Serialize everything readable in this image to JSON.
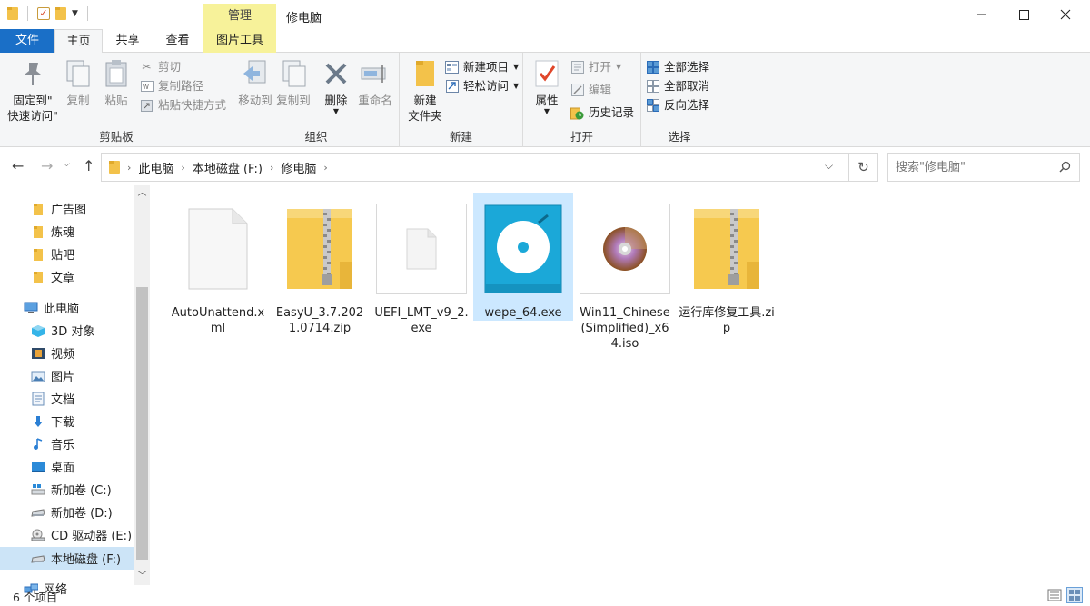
{
  "titlebar": {
    "context_tab": "管理",
    "title": "修电脑"
  },
  "tabs": {
    "file": "文件",
    "home": "主页",
    "share": "共享",
    "view": "查看",
    "picture_tools": "图片工具"
  },
  "ribbon": {
    "clipboard": {
      "label": "剪贴板",
      "pin_line1": "固定到\"",
      "pin_line2": "快速访问\"",
      "copy": "复制",
      "paste": "粘贴",
      "cut": "剪切",
      "copy_path": "复制路径",
      "paste_shortcut": "粘贴快捷方式"
    },
    "organize": {
      "label": "组织",
      "move_to": "移动到",
      "copy_to": "复制到",
      "delete": "删除",
      "rename": "重命名"
    },
    "new": {
      "label": "新建",
      "new_folder_line1": "新建",
      "new_folder_line2": "文件夹",
      "new_item": "新建项目",
      "easy_access": "轻松访问"
    },
    "open": {
      "label": "打开",
      "properties": "属性",
      "open": "打开",
      "edit": "编辑",
      "history": "历史记录"
    },
    "select": {
      "label": "选择",
      "select_all": "全部选择",
      "select_none": "全部取消",
      "invert": "反向选择"
    }
  },
  "address": {
    "crumbs": [
      "此电脑",
      "本地磁盘 (F:)",
      "修电脑"
    ],
    "search_placeholder": "搜索\"修电脑\""
  },
  "sidebar": {
    "items": [
      {
        "label": "广告图",
        "icon": "folder-icon"
      },
      {
        "label": "炼魂",
        "icon": "folder-icon"
      },
      {
        "label": "贴吧",
        "icon": "folder-icon"
      },
      {
        "label": "文章",
        "icon": "folder-icon"
      },
      {
        "label": "此电脑",
        "icon": "computer-icon"
      },
      {
        "label": "3D 对象",
        "icon": "cube-icon"
      },
      {
        "label": "视频",
        "icon": "film-icon"
      },
      {
        "label": "图片",
        "icon": "picture-icon"
      },
      {
        "label": "文档",
        "icon": "document-icon"
      },
      {
        "label": "下载",
        "icon": "download-icon"
      },
      {
        "label": "音乐",
        "icon": "music-icon"
      },
      {
        "label": "桌面",
        "icon": "desktop-icon"
      },
      {
        "label": "新加卷 (C:)",
        "icon": "windows-drive-icon"
      },
      {
        "label": "新加卷 (D:)",
        "icon": "drive-icon"
      },
      {
        "label": "CD 驱动器 (E:)",
        "icon": "cd-drive-icon"
      },
      {
        "label": "本地磁盘 (F:)",
        "icon": "drive-icon"
      },
      {
        "label": "网络",
        "icon": "network-icon"
      }
    ]
  },
  "files": [
    {
      "name": "AutoUnattend.xml",
      "icon": "blank-file-icon"
    },
    {
      "name": "EasyU_3.7.2021.0714.zip",
      "icon": "zip-folder-icon"
    },
    {
      "name": "UEFI_LMT_v9_2.exe",
      "icon": "exe-file-icon"
    },
    {
      "name": "wepe_64.exe",
      "icon": "wepe-app-icon"
    },
    {
      "name": "Win11_Chinese(Simplified)_x64.iso",
      "icon": "disc-image-icon"
    },
    {
      "name": "运行库修复工具.zip",
      "icon": "zip-folder-icon"
    }
  ],
  "status": {
    "count": "6 个项目"
  },
  "colors": {
    "accent": "#1a6fc7",
    "context_tab": "#f7f29a",
    "selection": "#cce8ff",
    "folder": "#f3c24a"
  }
}
